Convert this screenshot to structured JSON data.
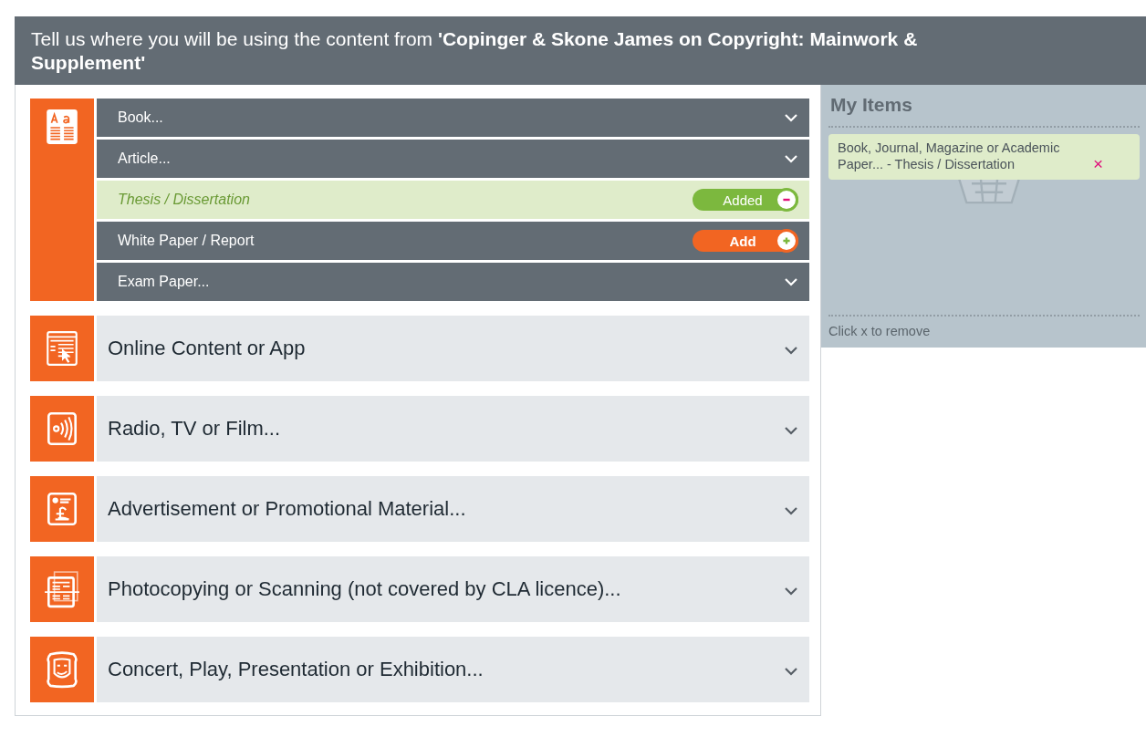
{
  "header": {
    "text": "Tell us where you will be using the content from **'Copinger & Skone James on Copyright: Mainwork & Supplement'**"
  },
  "categories": [
    {
      "kind": "book",
      "expanded": true,
      "items": [
        {
          "label": "Book...",
          "kind": "menu"
        },
        {
          "label": "Article...",
          "kind": "menu"
        },
        {
          "label": "Thesis / Dissertation",
          "kind": "option",
          "added": true,
          "button": "Added"
        },
        {
          "label": "White Paper / Report",
          "kind": "option",
          "added": false,
          "button": "Add"
        },
        {
          "label": "Exam Paper...",
          "kind": "menu"
        }
      ]
    },
    {
      "kind": "web",
      "expanded": false,
      "label": "Online Content or App"
    },
    {
      "kind": "radio",
      "expanded": false,
      "label": "Radio, TV or Film..."
    },
    {
      "kind": "advert",
      "expanded": false,
      "label": "Advertisement or Promotional Material..."
    },
    {
      "kind": "scan",
      "expanded": false,
      "label": "Photocopying or Scanning (not covered by CLA licence)..."
    },
    {
      "kind": "theatre",
      "expanded": false,
      "label": "Concert, Play, Presentation or Exhibition..."
    }
  ],
  "my_items": {
    "title": "My Items",
    "items": [
      "Book, Journal, Magazine or Academic Paper... - Thesis / Dissertation"
    ],
    "remove_mark": "×",
    "hint": "Click x to remove"
  }
}
